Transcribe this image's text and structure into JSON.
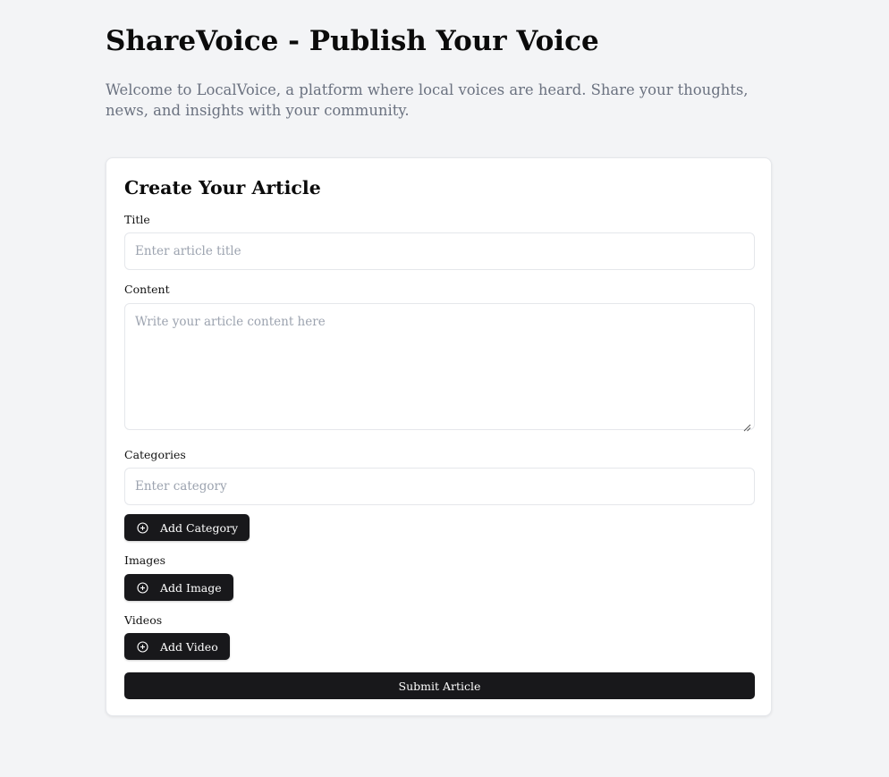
{
  "header": {
    "title": "ShareVoice - Publish Your Voice",
    "intro": "Welcome to LocalVoice, a platform where local voices are heard. Share your thoughts, news, and insights with your community."
  },
  "form": {
    "heading": "Create Your Article",
    "title_label": "Title",
    "title_placeholder": "Enter article title",
    "title_value": "",
    "content_label": "Content",
    "content_placeholder": "Write your article content here",
    "content_value": "",
    "categories_label": "Categories",
    "category_placeholder": "Enter category",
    "category_value": "",
    "add_category_label": "Add Category",
    "images_label": "Images",
    "add_image_label": "Add Image",
    "videos_label": "Videos",
    "add_video_label": "Add Video",
    "submit_label": "Submit Article"
  },
  "icons": {
    "add": "plus-circle-icon",
    "resize": "resize-grip-icon"
  },
  "colors": {
    "background": "#f3f4f6",
    "card": "#ffffff",
    "button": "#18181b",
    "muted_text": "#6b7280",
    "placeholder": "#9ca3af",
    "border": "#e5e7eb"
  }
}
